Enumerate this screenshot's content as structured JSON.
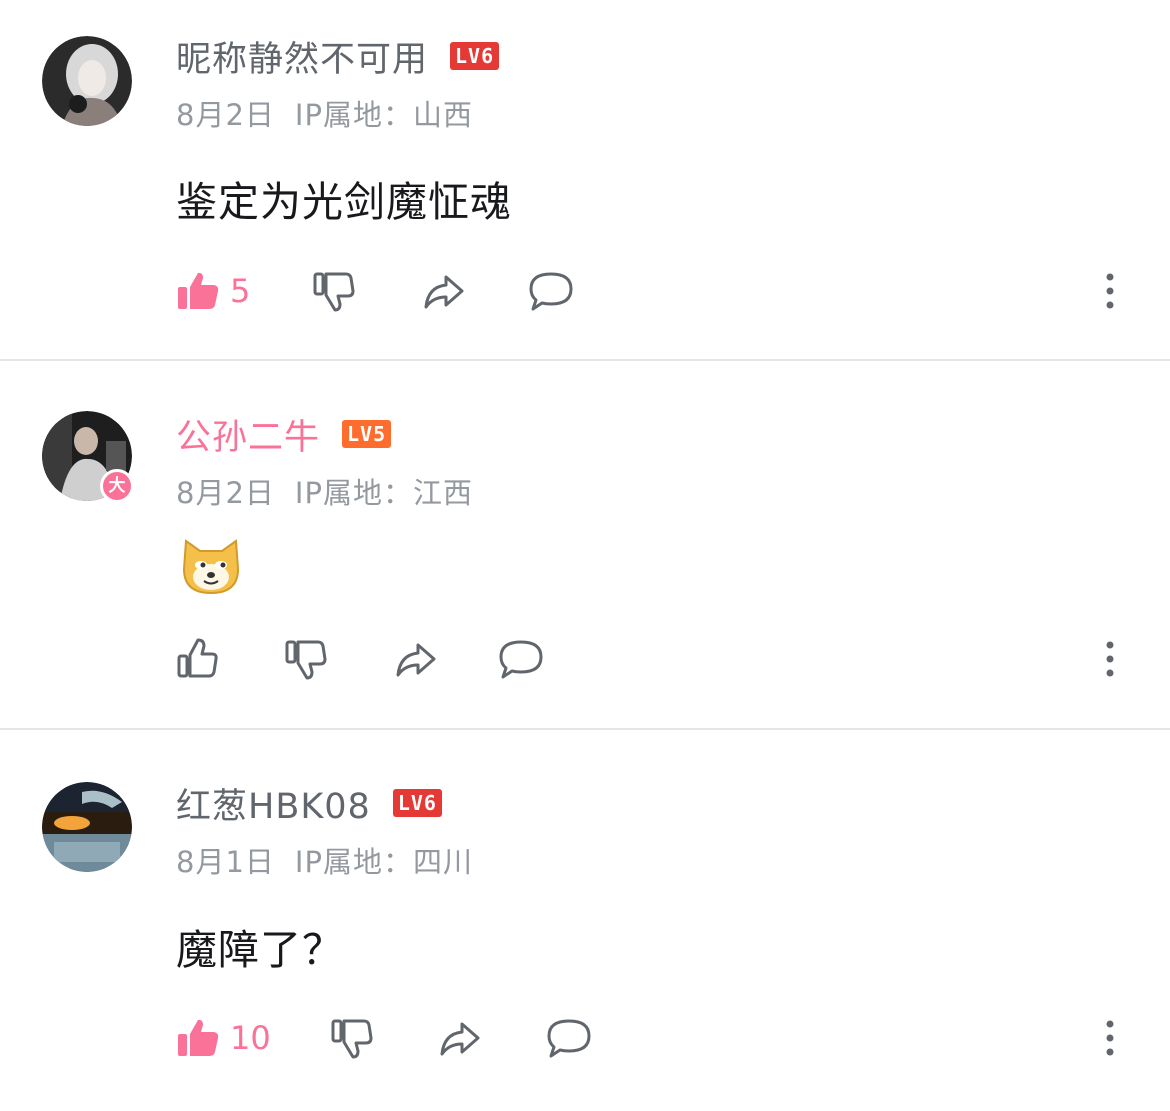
{
  "comments": [
    {
      "username": "昵称静然不可用",
      "level": "LV6",
      "level_color": "#e53935",
      "date": "8月2日",
      "ip": "IP属地：山西",
      "text": "鉴定为光剑魔怔魂",
      "like_count": "5",
      "liked": true,
      "avatar_icon": "user-avatar-grey-figure"
    },
    {
      "username": "公孙二牛",
      "level": "LV5",
      "level_color": "#ff6d2e",
      "date": "8月2日",
      "ip": "IP属地：江西",
      "badge": "大",
      "text_emoji": "doge-emoji",
      "liked": false,
      "avatar_icon": "user-avatar-dark-photo"
    },
    {
      "username": "红葱HBK08",
      "level": "LV6",
      "level_color": "#e53935",
      "date": "8月1日",
      "ip": "IP属地：四川",
      "text": "魔障了？",
      "like_count": "10",
      "liked": true,
      "avatar_icon": "user-avatar-game-scene"
    }
  ],
  "colors": {
    "accent_pink": "#fb7299",
    "text_primary": "#18191c",
    "text_secondary": "#61666d",
    "text_meta": "#9499a0",
    "icon_grey": "#61666d",
    "divider": "#e3e5e7"
  }
}
